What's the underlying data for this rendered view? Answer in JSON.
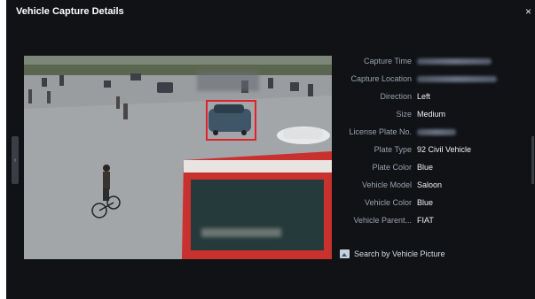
{
  "dialog": {
    "title": "Vehicle Capture Details",
    "close_glyph": "×",
    "close_icon": "close-icon"
  },
  "details": {
    "fields": [
      {
        "label": "Capture Time",
        "value": "",
        "obscured": true
      },
      {
        "label": "Capture Location",
        "value": "",
        "obscured": true
      },
      {
        "label": "Direction",
        "value": "Left",
        "obscured": false
      },
      {
        "label": "Size",
        "value": "Medium",
        "obscured": false
      },
      {
        "label": "License Plate No.",
        "value": "",
        "obscured": true
      },
      {
        "label": "Plate Type",
        "value": "92 Civil Vehicle",
        "obscured": false
      },
      {
        "label": "Plate Color",
        "value": "Blue",
        "obscured": false
      },
      {
        "label": "Vehicle Model",
        "value": "Saloon",
        "obscured": false
      },
      {
        "label": "Vehicle Color",
        "value": "Blue",
        "obscured": false
      },
      {
        "label": "Vehicle Parent...",
        "value": "FIAT",
        "obscured": false
      }
    ]
  },
  "search": {
    "label": "Search by Vehicle Picture",
    "icon": "picture-search-icon"
  },
  "colors": {
    "background": "#101216",
    "highlight_box": "#e0232b",
    "bus_red": "#c8312e"
  }
}
